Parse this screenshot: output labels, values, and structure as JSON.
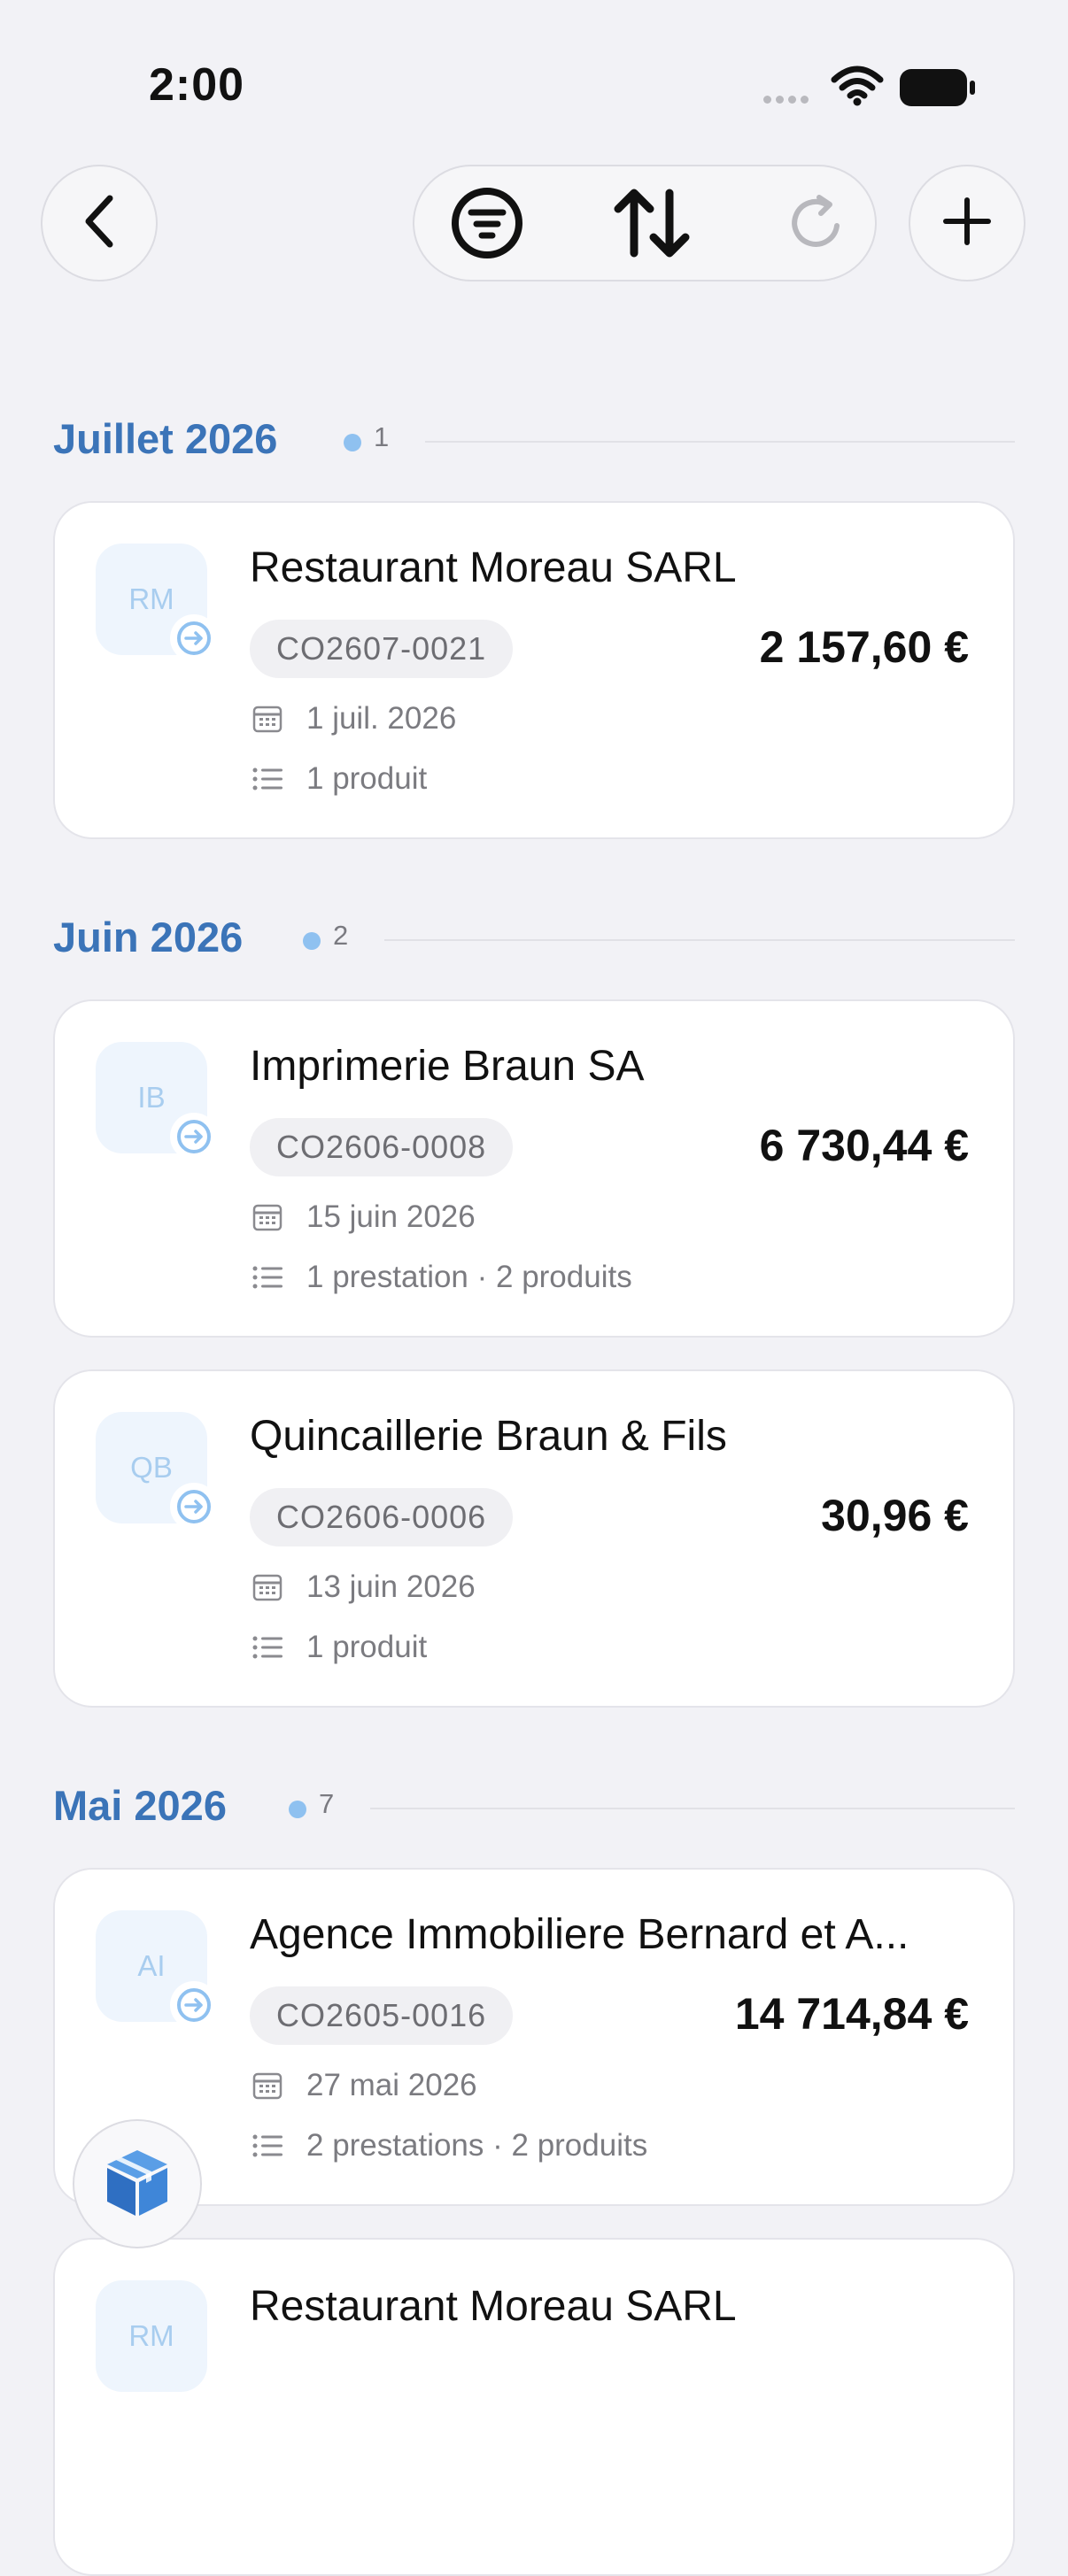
{
  "status_bar": {
    "time": "2:00"
  },
  "toolbar": {
    "back_icon": "chevron-left-icon",
    "filter_icon": "filter-circle-icon",
    "sort_icon": "sort-arrows-icon",
    "refresh_icon": "refresh-icon",
    "add_icon": "plus-icon"
  },
  "sections": [
    {
      "title": "Juillet 2026",
      "count": "1",
      "orders": [
        {
          "initials": "RM",
          "client": "Restaurant Moreau SARL",
          "ref": "CO2607-0021",
          "amount": "2 157,60 €",
          "date": "1 juil. 2026",
          "items": "1 produit"
        }
      ]
    },
    {
      "title": "Juin 2026",
      "count": "2",
      "orders": [
        {
          "initials": "IB",
          "client": "Imprimerie Braun SA",
          "ref": "CO2606-0008",
          "amount": "6 730,44 €",
          "date": "15 juin 2026",
          "items": "1 prestation · 2 produits"
        },
        {
          "initials": "QB",
          "client": "Quincaillerie Braun & Fils",
          "ref": "CO2606-0006",
          "amount": "30,96 €",
          "date": "13 juin 2026",
          "items": "1 produit"
        }
      ]
    },
    {
      "title": "Mai 2026",
      "count": "7",
      "orders": [
        {
          "initials": "AI",
          "client": "Agence Immobiliere Bernard et A...",
          "ref": "CO2605-0016",
          "amount": "14 714,84 €",
          "date": "27 mai 2026",
          "items": "2 prestations · 2 produits"
        },
        {
          "initials": "RM",
          "client": "Restaurant Moreau SARL"
        }
      ]
    }
  ],
  "fab": {
    "icon": "box-icon"
  },
  "colors": {
    "accent": "#3b74b8",
    "count_dot": "#8fc1f0",
    "background": "#f2f2f6"
  }
}
